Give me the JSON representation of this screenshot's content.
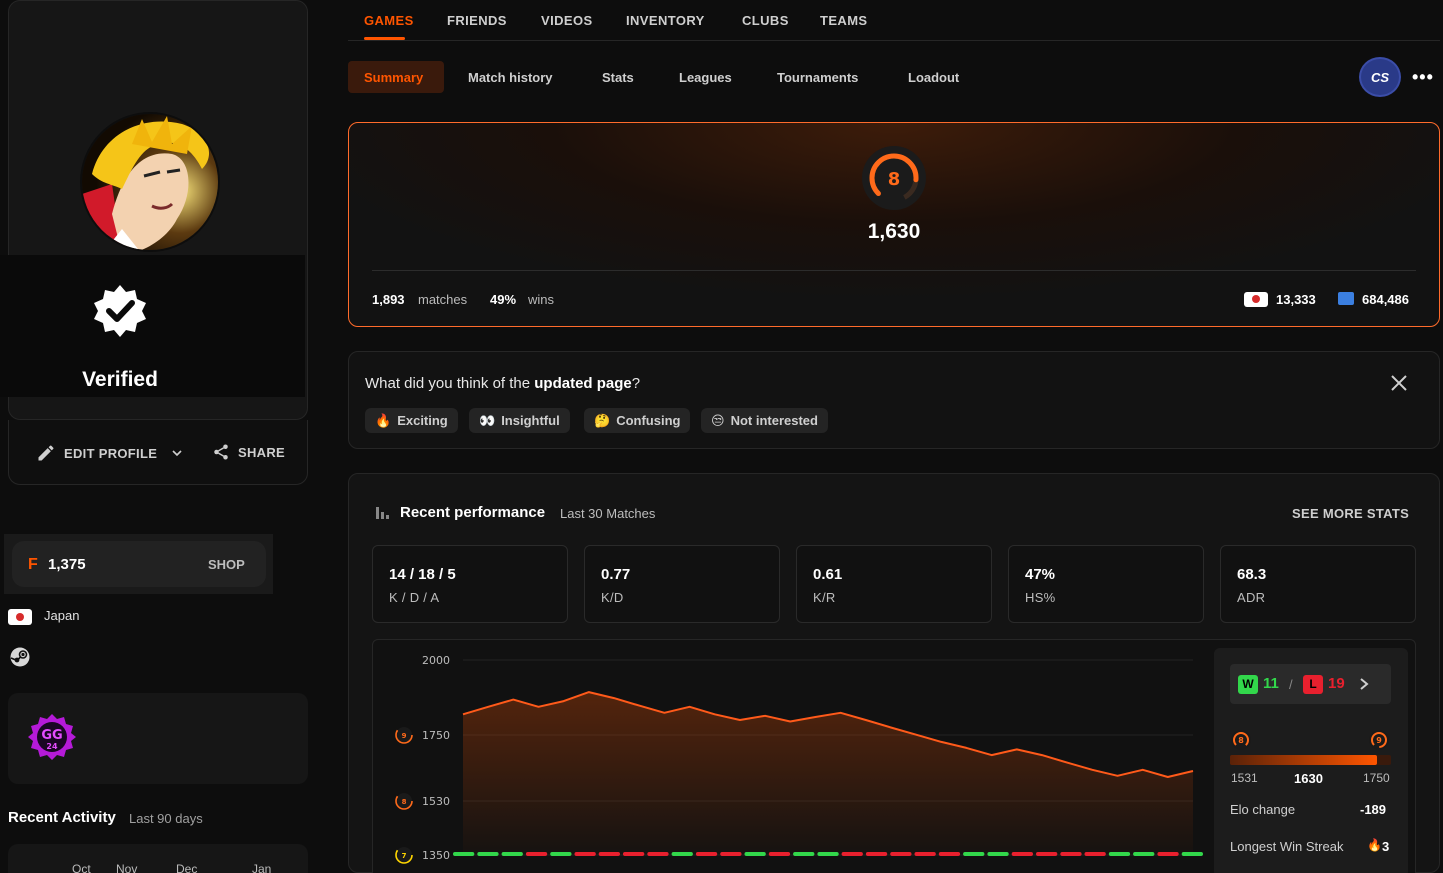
{
  "profile": {
    "verified_label": "Verified",
    "edit_profile_label": "EDIT PROFILE",
    "share_label": "SHARE",
    "points": "1,375",
    "shop_label": "SHOP",
    "country": "Japan",
    "recent_activity_title": "Recent Activity",
    "recent_activity_sub": "Last 90 days",
    "calendar_months": [
      "Oct",
      "Nov",
      "Dec",
      "Jan"
    ]
  },
  "topnav": {
    "items": [
      "GAMES",
      "FRIENDS",
      "VIDEOS",
      "INVENTORY",
      "CLUBS",
      "TEAMS"
    ],
    "active": "GAMES"
  },
  "subnav": {
    "items": [
      "Summary",
      "Match history",
      "Stats",
      "Leagues",
      "Tournaments",
      "Loadout"
    ],
    "active": "Summary",
    "game_label": "CS",
    "more_label": "•••"
  },
  "elo": {
    "level": "8",
    "value": "1,630",
    "matches": "1,893",
    "matches_label": "matches",
    "winrate": "49%",
    "wins_label": "wins",
    "country_rank": "13,333",
    "global_rank": "684,486"
  },
  "feedback": {
    "question_prefix": "What did you think of the ",
    "question_bold": "updated page",
    "question_suffix": "?",
    "options": [
      {
        "emoji": "🔥",
        "label": "Exciting"
      },
      {
        "emoji": "👀",
        "label": "Insightful"
      },
      {
        "emoji": "🤔",
        "label": "Confusing"
      },
      {
        "emoji": "😒",
        "label": "Not interested"
      }
    ]
  },
  "performance": {
    "title": "Recent performance",
    "subtitle": "Last 30 Matches",
    "see_more": "SEE MORE STATS",
    "stats": [
      {
        "value": "14 / 18 / 5",
        "label": "K / D / A"
      },
      {
        "value": "0.77",
        "label": "K/D"
      },
      {
        "value": "0.61",
        "label": "K/R"
      },
      {
        "value": "47%",
        "label": "HS%"
      },
      {
        "value": "68.3",
        "label": "ADR"
      }
    ],
    "wins": "11",
    "losses": "19",
    "win_letter": "W",
    "loss_letter": "L",
    "range_min": "1531",
    "range_current": "1630",
    "range_max": "1750",
    "range_fill": 0.91,
    "range_min_level": "8",
    "range_max_level": "9",
    "elo_change_label": "Elo change",
    "elo_change": "-189",
    "streak_label": "Longest Win Streak",
    "streak": "3"
  },
  "chart_data": {
    "type": "area",
    "title": "",
    "xlabel": "",
    "ylabel": "",
    "ylim": [
      1350,
      2000
    ],
    "y_ticks": [
      {
        "value": 2000,
        "label": "2000",
        "level": ""
      },
      {
        "value": 1750,
        "label": "1750",
        "level": "9"
      },
      {
        "value": 1530,
        "label": "1530",
        "level": "8"
      },
      {
        "value": 1350,
        "label": "1350",
        "level": "7"
      }
    ],
    "x": [
      1,
      2,
      3,
      4,
      5,
      6,
      7,
      8,
      9,
      10,
      11,
      12,
      13,
      14,
      15,
      16,
      17,
      18,
      19,
      20,
      21,
      22,
      23,
      24,
      25,
      26,
      27,
      28,
      29,
      30
    ],
    "series": [
      {
        "values": [
          1819,
          1844,
          1868,
          1844,
          1863,
          1893,
          1873,
          1848,
          1824,
          1844,
          1819,
          1800,
          1814,
          1795,
          1810,
          1824,
          1800,
          1775,
          1751,
          1727,
          1707,
          1683,
          1702,
          1683,
          1658,
          1634,
          1614,
          1634,
          1610,
          1630
        ]
      }
    ],
    "results": [
      "W",
      "W",
      "W",
      "L",
      "W",
      "L",
      "L",
      "L",
      "L",
      "W",
      "L",
      "L",
      "W",
      "L",
      "W",
      "W",
      "L",
      "L",
      "L",
      "L",
      "L",
      "W",
      "W",
      "L",
      "L",
      "L",
      "L",
      "W",
      "W",
      "L",
      "W"
    ]
  },
  "colors": {
    "accent": "#ff5500",
    "win": "#32d74b",
    "loss": "#e8202e"
  }
}
